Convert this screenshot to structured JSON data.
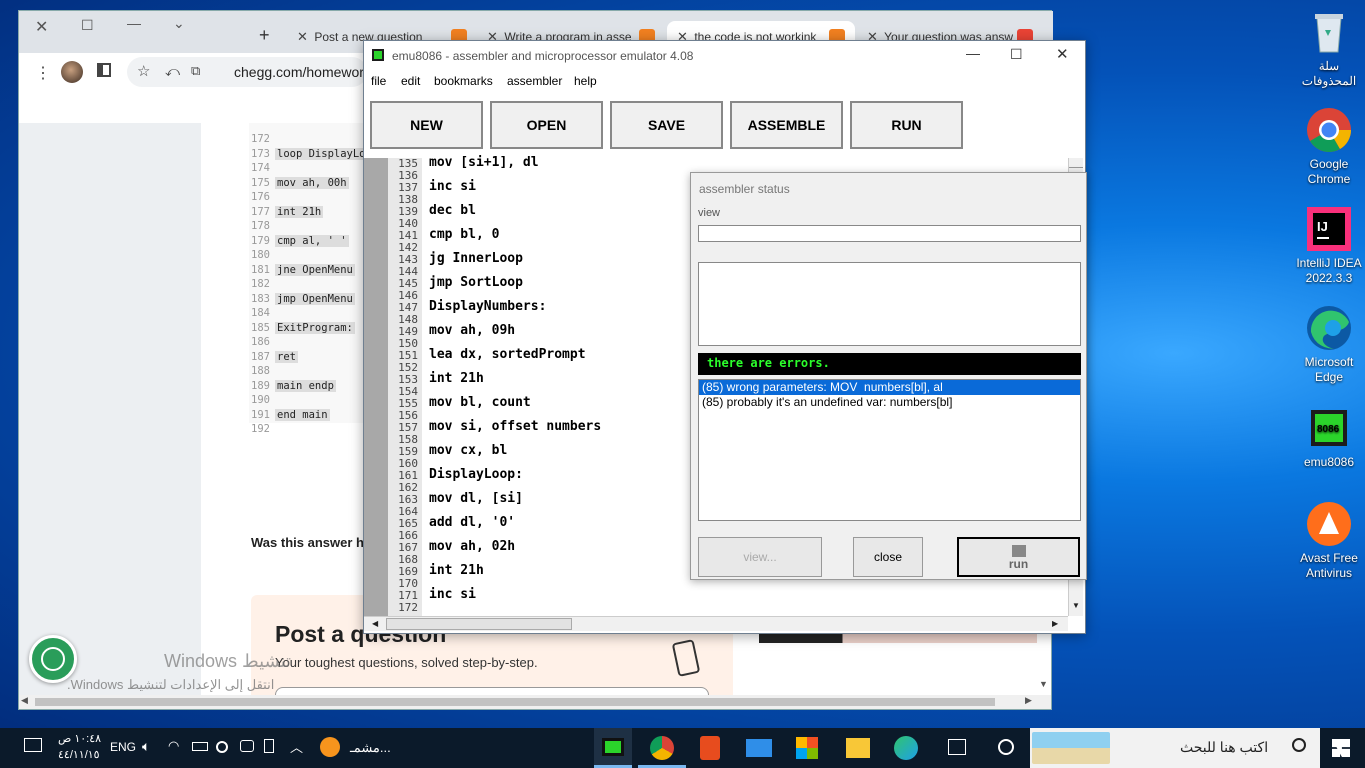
{
  "desktop": {
    "icons": [
      {
        "name": "recycle-bin",
        "label": "سلة\nالمحذوفات"
      },
      {
        "name": "google-chrome",
        "label": "Google\nChrome"
      },
      {
        "name": "intellij",
        "label": "IntelliJ IDEA\n2022.3.3"
      },
      {
        "name": "edge",
        "label": "Microsoft\nEdge"
      },
      {
        "name": "emu8086",
        "label": "emu8086"
      },
      {
        "name": "avast",
        "label": "Avast Free\nAntivirus"
      }
    ],
    "activate_title": "تنشيط Windows",
    "activate_sub": "انتقل إلى الإعدادات لتنشيط Windows."
  },
  "chrome": {
    "tabs": [
      "Post a new question",
      "Write a program in asse",
      "the code is not workink",
      "Your question was answ"
    ],
    "url": "chegg.com/homewor",
    "code_lines": [
      {
        "n": "172",
        "t": ""
      },
      {
        "n": "173",
        "t": "loop DisplayLo"
      },
      {
        "n": "174",
        "t": ""
      },
      {
        "n": "175",
        "t": "mov ah, 00h"
      },
      {
        "n": "176",
        "t": ""
      },
      {
        "n": "177",
        "t": "int 21h"
      },
      {
        "n": "178",
        "t": ""
      },
      {
        "n": "179",
        "t": "cmp al, ' '"
      },
      {
        "n": "180",
        "t": ""
      },
      {
        "n": "181",
        "t": "jne OpenMenu"
      },
      {
        "n": "182",
        "t": ""
      },
      {
        "n": "183",
        "t": "jmp OpenMenu"
      },
      {
        "n": "184",
        "t": ""
      },
      {
        "n": "185",
        "t": "ExitProgram:"
      },
      {
        "n": "186",
        "t": ""
      },
      {
        "n": "187",
        "t": "ret"
      },
      {
        "n": "188",
        "t": ""
      },
      {
        "n": "189",
        "t": "main endp"
      },
      {
        "n": "190",
        "t": ""
      },
      {
        "n": "191",
        "t": "end main"
      },
      {
        "n": "192",
        "t": ""
      }
    ],
    "was_helpful": "Was this answer h",
    "post_title": "Post a question",
    "post_sub": "Your toughest questions, solved step-by-step."
  },
  "emu": {
    "title": "emu8086 - assembler and microprocessor emulator 4.08",
    "menu": [
      "file",
      "edit",
      "bookmarks",
      "assembler",
      "help"
    ],
    "buttons": [
      "NEW",
      "OPEN",
      "SAVE",
      "ASSEMBLE",
      "RUN"
    ],
    "lines": [
      {
        "n": "135",
        "c": "mov [si+1], dl"
      },
      {
        "n": "136",
        "c": ""
      },
      {
        "n": "137",
        "c": "inc si"
      },
      {
        "n": "138",
        "c": ""
      },
      {
        "n": "139",
        "c": "dec bl"
      },
      {
        "n": "140",
        "c": ""
      },
      {
        "n": "141",
        "c": "cmp bl, 0"
      },
      {
        "n": "142",
        "c": ""
      },
      {
        "n": "143",
        "c": "jg InnerLoop"
      },
      {
        "n": "144",
        "c": ""
      },
      {
        "n": "145",
        "c": "jmp SortLoop"
      },
      {
        "n": "146",
        "c": ""
      },
      {
        "n": "147",
        "c": "DisplayNumbers:"
      },
      {
        "n": "148",
        "c": ""
      },
      {
        "n": "149",
        "c": "mov ah, 09h"
      },
      {
        "n": "150",
        "c": ""
      },
      {
        "n": "151",
        "c": "lea dx, sortedPrompt"
      },
      {
        "n": "152",
        "c": ""
      },
      {
        "n": "153",
        "c": "int 21h"
      },
      {
        "n": "154",
        "c": ""
      },
      {
        "n": "155",
        "c": "mov bl, count"
      },
      {
        "n": "156",
        "c": ""
      },
      {
        "n": "157",
        "c": "mov si, offset numbers"
      },
      {
        "n": "158",
        "c": ""
      },
      {
        "n": "159",
        "c": "mov cx, bl"
      },
      {
        "n": "160",
        "c": ""
      },
      {
        "n": "161",
        "c": "DisplayLoop:"
      },
      {
        "n": "162",
        "c": ""
      },
      {
        "n": "163",
        "c": "mov dl, [si]"
      },
      {
        "n": "164",
        "c": ""
      },
      {
        "n": "165",
        "c": "add dl, '0'"
      },
      {
        "n": "166",
        "c": ""
      },
      {
        "n": "167",
        "c": "mov ah, 02h"
      },
      {
        "n": "168",
        "c": ""
      },
      {
        "n": "169",
        "c": "int 21h"
      },
      {
        "n": "170",
        "c": ""
      },
      {
        "n": "171",
        "c": "inc si"
      },
      {
        "n": "172",
        "c": ""
      }
    ]
  },
  "status": {
    "title": "assembler status",
    "view_label": "view",
    "errors_banner": "there are errors.",
    "errors": [
      "(85) wrong parameters: MOV  numbers[bl], al",
      "(85) probably it's an undefined var: numbers[bl]"
    ],
    "btn_view": "view...",
    "btn_close": "close",
    "btn_run": "run"
  },
  "taskbar": {
    "search_placeholder": "اكتب هنا للبحث",
    "lang": "ENG",
    "time": "١٠:٤٨ ص",
    "date": "٤٤/١١/١٥",
    "app_label": "مشمـ..."
  }
}
